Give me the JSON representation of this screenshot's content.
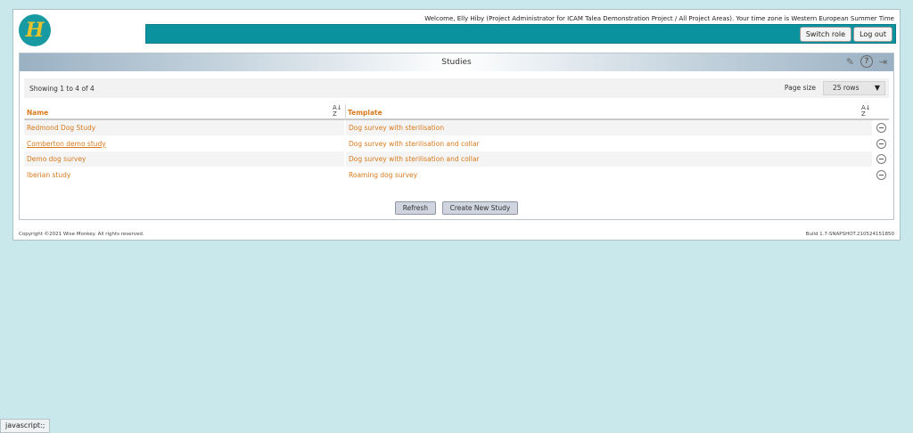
{
  "header": {
    "welcome_text": "Welcome, Elly Hiby (Project Administrator for ICAM Talea Demonstration Project / All Project Areas). Your time zone is Western European Summer Time",
    "logo_icon": "talea-logo-icon",
    "logo_glyph": "H",
    "switch_role_label": "Switch role",
    "logout_label": "Log out",
    "bar_color": "#0a939f"
  },
  "panel": {
    "title": "Studies",
    "icons": [
      "pencil-icon",
      "help-icon",
      "exit-icon"
    ],
    "icon_glyphs": {
      "pencil": "✎",
      "help": "?",
      "exit": "⇥"
    }
  },
  "toolbar": {
    "showing_text": "Showing 1 to 4 of 4",
    "page_size_label": "Page size",
    "page_size_value": "25 rows",
    "caret": "▼"
  },
  "table": {
    "columns": [
      "Name",
      "Template"
    ],
    "sort_glyph_top": "A",
    "sort_glyph_bottom": "Z",
    "sort_arrow": "↓",
    "rows": [
      {
        "name": "Redmond Dog Study",
        "template": "Dog survey with sterilisation"
      },
      {
        "name": "Comberton demo study",
        "template": "Dog survey with sterilisation and collar"
      },
      {
        "name": "Demo dog survey",
        "template": "Dog survey with sterilisation and collar"
      },
      {
        "name": "Iberian study",
        "template": "Roaming dog survey"
      }
    ],
    "link_color": "#d9791c"
  },
  "actions": {
    "refresh_label": "Refresh",
    "create_label": "Create New Study"
  },
  "footer": {
    "copyright": "Copyright ©2021 Wise Monkey. All rights reserved.",
    "build": "Build 1.7-SNAPSHOT.210524151850"
  },
  "statusbar": {
    "text": "javascript:;"
  }
}
